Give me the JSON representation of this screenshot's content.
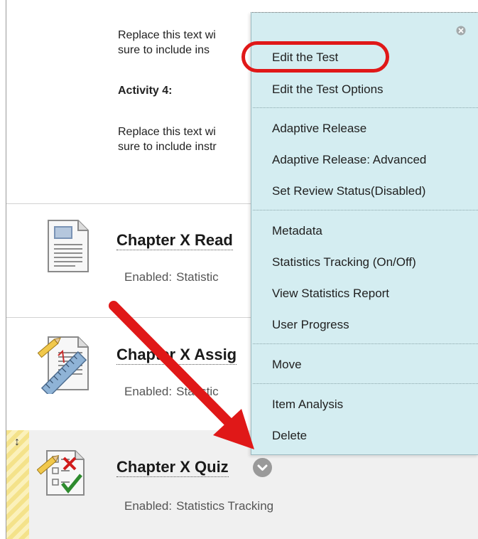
{
  "top_block": {
    "line1": "Replace this text wi",
    "line2": "sure to include ins",
    "activity_heading": "Activity 4:",
    "line3": "Replace this text wi",
    "line4": "sure to include instr"
  },
  "items": [
    {
      "title": "Chapter X Read",
      "meta_label": "Enabled:",
      "meta_value": "Statistic",
      "icon": "document-icon"
    },
    {
      "title": "Chapter X Assig",
      "meta_label": "Enabled:",
      "meta_value": "Statistic",
      "icon": "assignment-icon"
    },
    {
      "title": "Chapter X Quiz",
      "meta_label": "Enabled:",
      "meta_value": "Statistics Tracking",
      "icon": "test-icon"
    }
  ],
  "menu": {
    "groups": [
      [
        "Edit the Test",
        "Edit the Test Options"
      ],
      [
        "Adaptive Release",
        "Adaptive Release: Advanced",
        "Set Review Status(Disabled)"
      ],
      [
        "Metadata",
        "Statistics Tracking (On/Off)",
        "View Statistics Report",
        "User Progress"
      ],
      [
        "Move"
      ],
      [
        "Item Analysis",
        "Delete"
      ]
    ]
  },
  "colors": {
    "menu_bg": "#d4edf1",
    "annotation_red": "#e01818",
    "drag_strip": "#f4e28a"
  }
}
